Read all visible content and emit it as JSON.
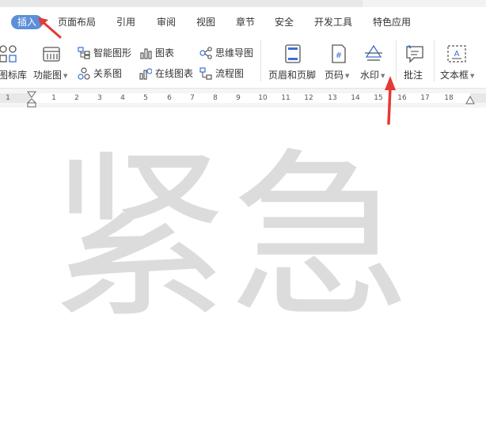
{
  "menu": {
    "tabs": [
      "插入",
      "页面布局",
      "引用",
      "审阅",
      "视图",
      "章节",
      "安全",
      "开发工具",
      "特色应用"
    ],
    "active": "插入"
  },
  "ribbon": {
    "icon_lib": "图标库",
    "func_chart": "功能图",
    "smart_shape": "智能图形",
    "chart": "图表",
    "mind_map": "思维导图",
    "relation": "关系图",
    "online_chart": "在线图表",
    "flowchart": "流程图",
    "header_footer": "页眉和页脚",
    "page_number": "页码",
    "watermark": "水印",
    "comment": "批注",
    "textbox": "文本框"
  },
  "ruler": {
    "ticks": [
      "1",
      "1",
      "2",
      "3",
      "4",
      "5",
      "6",
      "7",
      "8",
      "9",
      "10",
      "11",
      "12",
      "13",
      "14",
      "15",
      "16",
      "17",
      "18"
    ]
  },
  "document": {
    "watermark_text": "紧急"
  },
  "colors": {
    "active_tab_bg": "#5b8fd8",
    "annotation_arrow": "#e53935",
    "watermark": "#dcdcdc",
    "icon_blue": "#3a6fd8"
  }
}
